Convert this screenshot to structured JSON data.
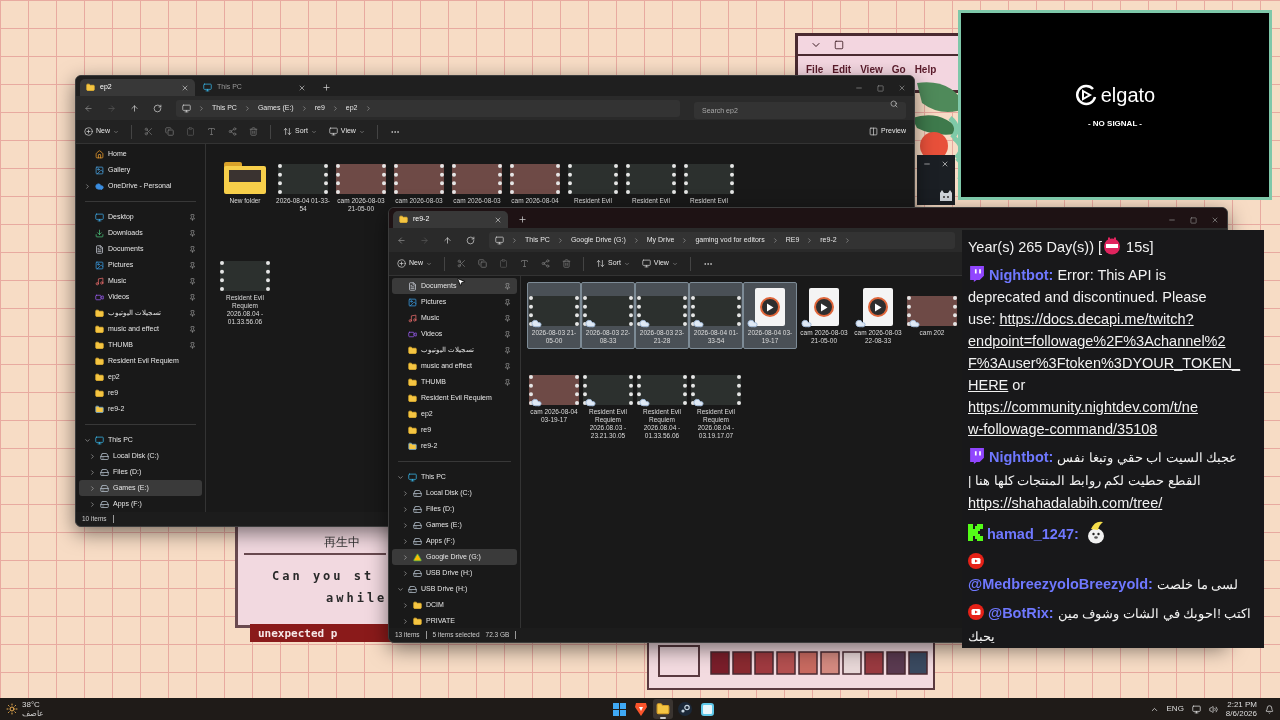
{
  "desktop": {
    "menu": [
      "File",
      "Edit",
      "View",
      "Go",
      "Help"
    ],
    "dialog": {
      "lines": [
        "再生中",
        "Can you st",
        "awhile"
      ],
      "banner": "unexpected p"
    }
  },
  "window_1": {
    "tabs": [
      {
        "label": "ep2",
        "kind": "folder",
        "selected": true
      },
      {
        "label": "This PC",
        "kind": "pc",
        "selected": false
      }
    ],
    "breadcrumb": [
      "This PC",
      "Games (E:)",
      "re9",
      "ep2"
    ],
    "search": {
      "placeholder": "Search ep2"
    },
    "toolbar": {
      "new": "New",
      "sort": "Sort",
      "view": "View",
      "preview": "Preview"
    },
    "sidebar": {
      "quick": [
        {
          "label": "Home",
          "kind": "home",
          "selected": false
        },
        {
          "label": "Gallery",
          "kind": "gallery",
          "selected": false
        },
        {
          "label": "OneDrive - Personal",
          "kind": "cloud",
          "selected": false,
          "expanded": false
        }
      ],
      "pinned": [
        {
          "label": "Desktop",
          "kind": "desktop",
          "selected": false,
          "pinned": true
        },
        {
          "label": "Downloads",
          "kind": "download",
          "selected": false,
          "pinned": true
        },
        {
          "label": "Documents",
          "kind": "documents",
          "selected": false,
          "pinned": true
        },
        {
          "label": "Pictures",
          "kind": "pictures",
          "selected": false,
          "pinned": true
        },
        {
          "label": "Music",
          "kind": "music",
          "selected": false,
          "pinned": true
        },
        {
          "label": "Videos",
          "kind": "videos",
          "selected": false,
          "pinned": true
        },
        {
          "label": "تسجيلات اليوتيوب",
          "kind": "folder",
          "selected": false,
          "pinned": true
        },
        {
          "label": "music and effect",
          "kind": "folder",
          "selected": false,
          "pinned": true
        },
        {
          "label": "THUMB",
          "kind": "folder",
          "selected": false,
          "pinned": true
        },
        {
          "label": "Resident Evil Requiem",
          "kind": "folder",
          "selected": false,
          "pinned": false
        },
        {
          "label": "ep2",
          "kind": "folder",
          "selected": false,
          "pinned": false
        },
        {
          "label": "re9",
          "kind": "folder",
          "selected": false,
          "pinned": false
        },
        {
          "label": "re9-2",
          "kind": "synced-folder",
          "selected": false,
          "pinned": false
        }
      ],
      "tree": [
        {
          "label": "This PC",
          "kind": "pc",
          "selected": false,
          "expanded": true,
          "children": [
            {
              "label": "Local Disk (C:)",
              "kind": "disk",
              "selected": false,
              "expanded": false
            },
            {
              "label": "Files (D:)",
              "kind": "disk",
              "selected": false,
              "expanded": false
            },
            {
              "label": "Games (E:)",
              "kind": "disk",
              "selected": true,
              "expanded": false
            },
            {
              "label": "Apps (F:)",
              "kind": "disk",
              "selected": false,
              "expanded": false
            }
          ]
        }
      ]
    },
    "files": [
      {
        "label": "New folder",
        "kind": "folder",
        "selected": false,
        "cloud": false
      },
      {
        "label": "2026-08-04 01-33-54",
        "kind": "video",
        "selected": false,
        "cloud": false
      },
      {
        "label": "cam 2026-08-03 21-05-00",
        "kind": "cam",
        "selected": false,
        "cloud": false
      },
      {
        "label": "cam 2026-08-03",
        "kind": "cam",
        "selected": false,
        "cloud": false
      },
      {
        "label": "cam 2026-08-03",
        "kind": "cam",
        "selected": false,
        "cloud": false
      },
      {
        "label": "cam 2026-08-04",
        "kind": "cam",
        "selected": false,
        "cloud": false
      },
      {
        "label": "Resident Evil",
        "kind": "video",
        "selected": false,
        "cloud": false
      },
      {
        "label": "Resident Evil",
        "kind": "video",
        "selected": false,
        "cloud": false
      },
      {
        "label": "Resident Evil",
        "kind": "video",
        "selected": false,
        "cloud": false
      },
      {
        "label": "Resident Evil Requiem 2026.08.04 - 01.33.56.06",
        "kind": "video",
        "selected": false,
        "cloud": false
      }
    ],
    "status_bar": {
      "items": "10 items"
    }
  },
  "window_2": {
    "tabs": [
      {
        "label": "re9-2",
        "kind": "folder",
        "selected": true
      }
    ],
    "breadcrumb": [
      "This PC",
      "Google Drive (G:)",
      "My Drive",
      "gaming vod for editors",
      "RE9",
      "re9-2"
    ],
    "toolbar": {
      "new": "New",
      "sort": "Sort",
      "view": "View"
    },
    "sidebar": {
      "pinned": [
        {
          "label": "Documents",
          "kind": "documents",
          "selected": true,
          "pinned": true
        },
        {
          "label": "Pictures",
          "kind": "pictures",
          "selected": false,
          "pinned": true
        },
        {
          "label": "Music",
          "kind": "music",
          "selected": false,
          "pinned": true
        },
        {
          "label": "Videos",
          "kind": "videos",
          "selected": false,
          "pinned": true
        },
        {
          "label": "تسجيلات اليوتيوب",
          "kind": "folder",
          "selected": false,
          "pinned": true
        },
        {
          "label": "music and effect",
          "kind": "folder",
          "selected": false,
          "pinned": true
        },
        {
          "label": "THUMB",
          "kind": "folder",
          "selected": false,
          "pinned": true
        },
        {
          "label": "Resident Evil Requiem",
          "kind": "folder",
          "selected": false,
          "pinned": false
        },
        {
          "label": "ep2",
          "kind": "folder",
          "selected": false,
          "pinned": false
        },
        {
          "label": "re9",
          "kind": "folder",
          "selected": false,
          "pinned": false
        },
        {
          "label": "re9-2",
          "kind": "synced-folder",
          "selected": false,
          "pinned": false
        }
      ],
      "tree": [
        {
          "label": "This PC",
          "kind": "pc",
          "selected": false,
          "expanded": true,
          "children": [
            {
              "label": "Local Disk (C:)",
              "kind": "disk",
              "selected": false,
              "expanded": false
            },
            {
              "label": "Files (D:)",
              "kind": "disk",
              "selected": false,
              "expanded": false
            },
            {
              "label": "Games (E:)",
              "kind": "disk",
              "selected": false,
              "expanded": false
            },
            {
              "label": "Apps (F:)",
              "kind": "disk",
              "selected": false,
              "expanded": false
            },
            {
              "label": "Google Drive (G:)",
              "kind": "gdrive",
              "selected": true,
              "expanded": false
            },
            {
              "label": "USB Drive (H:)",
              "kind": "disk",
              "selected": false,
              "expanded": false
            }
          ]
        },
        {
          "label": "USB Drive (H:)",
          "kind": "disk",
          "selected": false,
          "expanded": true,
          "children": [
            {
              "label": "DCIM",
              "kind": "folder",
              "selected": false,
              "expanded": false
            },
            {
              "label": "PRIVATE",
              "kind": "folder",
              "selected": false,
              "expanded": false
            }
          ]
        }
      ]
    },
    "files": [
      {
        "label": "2026-08-03 21-05-00",
        "kind": "video",
        "selected": true,
        "cloud": true
      },
      {
        "label": "2026-08-03 22-08-33",
        "kind": "video",
        "selected": true,
        "cloud": true
      },
      {
        "label": "2026-08-03 23-21-28",
        "kind": "video",
        "selected": true,
        "cloud": true
      },
      {
        "label": "2026-08-04 01-33-54",
        "kind": "video",
        "selected": true,
        "cloud": true
      },
      {
        "label": "2026-08-04 03-19-17",
        "kind": "media",
        "selected": true,
        "cloud": true
      },
      {
        "label": "cam 2026-08-03 21-05-00",
        "kind": "media",
        "selected": false,
        "cloud": true
      },
      {
        "label": "cam 2026-08-03 22-08-33",
        "kind": "media",
        "selected": false,
        "cloud": true
      },
      {
        "label": "cam 202",
        "kind": "cam",
        "selected": false,
        "cloud": true
      },
      {
        "label": "cam 2026-08-04 03-19-17",
        "kind": "cam",
        "selected": false,
        "cloud": true
      },
      {
        "label": "Resident Evil Requiem 2026.08.03 - 23.21.30.05",
        "kind": "video",
        "selected": false,
        "cloud": true
      },
      {
        "label": "Resident Evil Requiem 2026.08.04 - 01.33.56.06",
        "kind": "video",
        "selected": false,
        "cloud": true
      },
      {
        "label": "Resident Evil Requiem 2026.08.04 - 03.19.17.07",
        "kind": "video",
        "selected": false,
        "cloud": true
      }
    ],
    "status_bar": {
      "items": "13 items",
      "selected": "5 items selected",
      "size": "72.3 GB"
    }
  },
  "capture": {
    "logo": "elgato",
    "status": "- NO SIGNAL -"
  },
  "chat": {
    "messages": [
      {
        "kind": "none",
        "lines": [
          [
            {
              "kind": "text",
              "text": "Year(s) 265 Day(s)) ["
            },
            {
              "kind": "calendar"
            },
            {
              "kind": "text",
              "text": " 15s]"
            }
          ]
        ]
      },
      {
        "kind": "twitch",
        "user": "Nightbot:",
        "lines": [
          [
            {
              "kind": "text",
              "text": "Error: This API is"
            }
          ],
          [
            {
              "kind": "text",
              "text": "deprecated and discontinued. Please"
            }
          ],
          [
            {
              "kind": "text",
              "text": "use: "
            },
            {
              "kind": "link",
              "text": "https://docs.decapi.me/twitch?"
            }
          ],
          [
            {
              "kind": "link",
              "text": "endpoint=followage%2F%3Achannel%2"
            }
          ],
          [
            {
              "kind": "link",
              "text": "F%3Auser%3Ftoken%3DYOUR_TOKEN_"
            }
          ],
          [
            {
              "kind": "link",
              "text": "HERE"
            },
            {
              "kind": "text",
              "text": " or"
            }
          ],
          [
            {
              "kind": "link",
              "text": "https://community.nightdev.com/t/ne"
            }
          ],
          [
            {
              "kind": "link",
              "text": "w-followage-command/35108"
            }
          ]
        ]
      },
      {
        "kind": "twitch",
        "user": "Nightbot:",
        "lines": [
          [
            {
              "kind": "rtl",
              "text": "عجبك السيت اب حقي وتبغا نفس"
            }
          ],
          [
            {
              "kind": "rtl",
              "text": "القطع حطيت لكم روابط المنتجات كلها هنا |"
            }
          ],
          [
            {
              "kind": "link",
              "text": "https://shahadalabih.com/tree/"
            }
          ]
        ]
      },
      {
        "kind": "kick",
        "user": "hamad_1247:",
        "lines": [
          [
            {
              "kind": "emote"
            }
          ]
        ]
      },
      {
        "kind": "youtube",
        "user": "@MedbreezyoloBreezyold:",
        "lines": [
          [
            {
              "kind": "rtl",
              "text": "لسى ما خلصت"
            }
          ]
        ]
      },
      {
        "kind": "youtube",
        "user": "@BotRix:",
        "lines": [
          [
            {
              "kind": "rtl",
              "text": "اكتب !احوبك في الشات وشوف مين"
            }
          ],
          [
            {
              "kind": "rtl",
              "text": "يحبك"
            }
          ]
        ]
      }
    ]
  },
  "taskbar": {
    "weather": {
      "temp": "38°C",
      "condition": "عاصف"
    },
    "apps": [
      {
        "kind": "start",
        "active": false
      },
      {
        "kind": "browser",
        "active": false
      },
      {
        "kind": "explorer",
        "active": true
      },
      {
        "kind": "steam",
        "active": false
      },
      {
        "kind": "app",
        "active": false
      }
    ],
    "tray": {
      "language": "ENG",
      "time": "2:21 PM",
      "date": "8/6/2026"
    }
  }
}
